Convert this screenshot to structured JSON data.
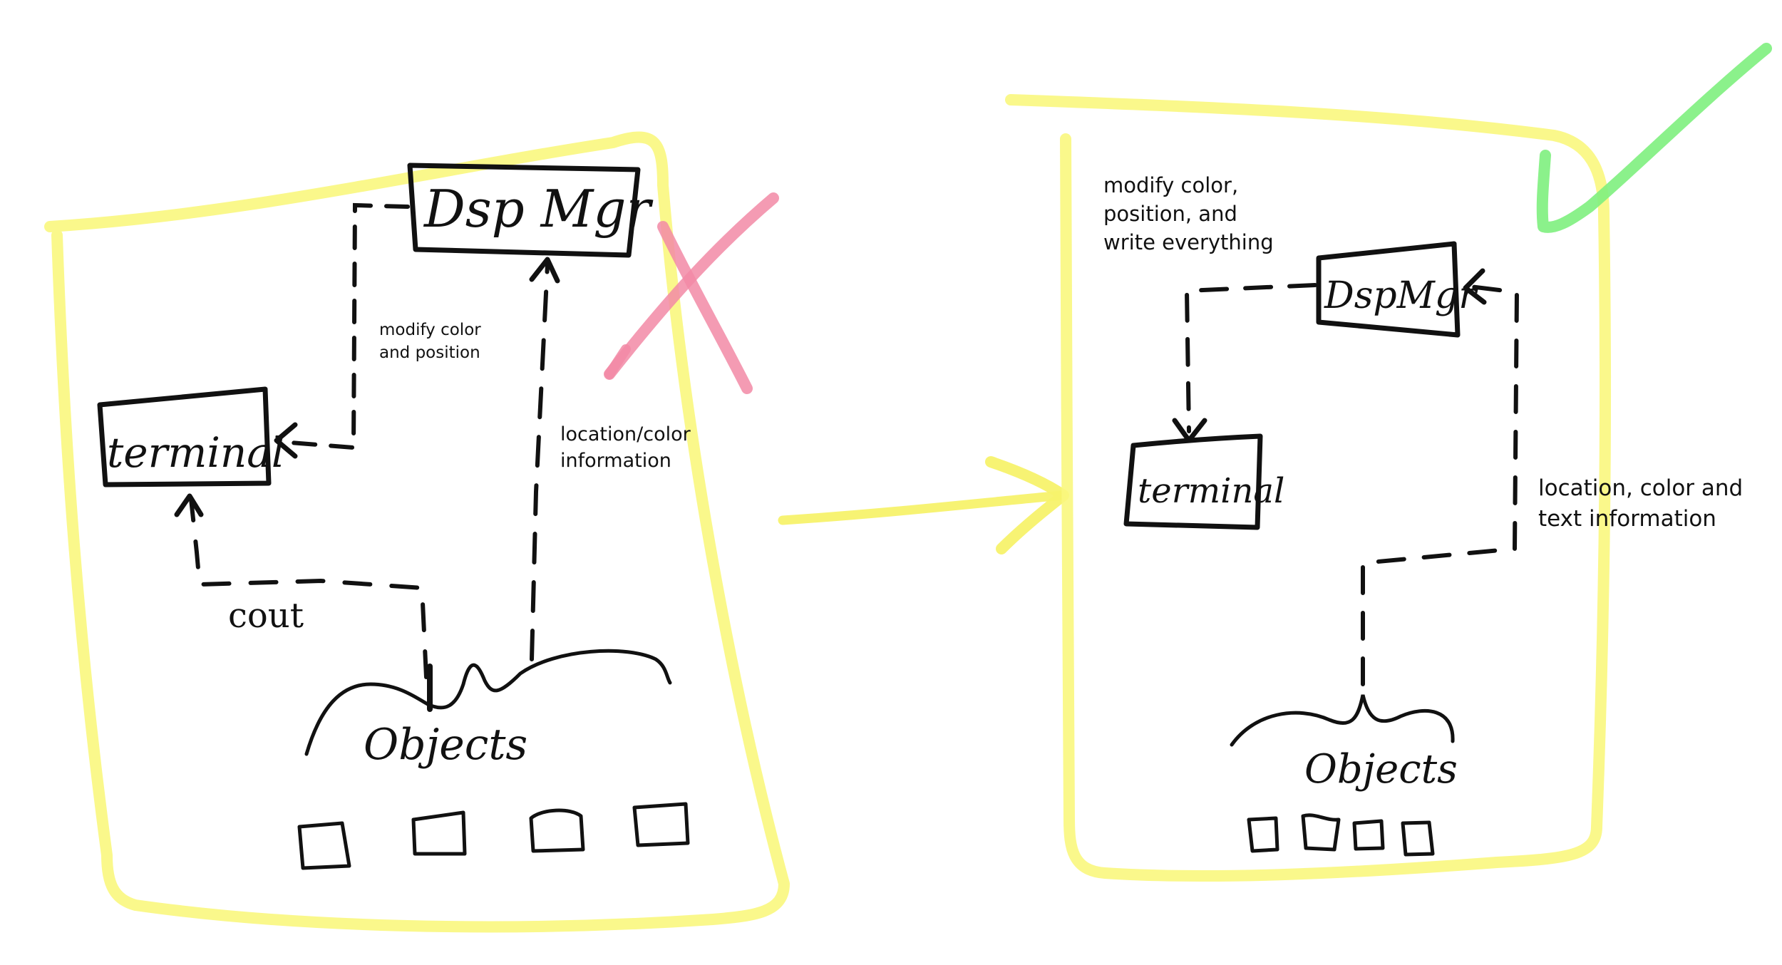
{
  "colors": {
    "ink": "#111111",
    "highlight_yellow": "#faf77e",
    "reject_pink": "#f28aa6",
    "approve_green": "#7ef07e",
    "transition_arrow": "#f7f26b",
    "background": "#ffffff"
  },
  "left_diagram": {
    "dspmgr_label": "Dsp Mgr",
    "terminal_label": "terminal",
    "note_modify_line1": "modify color",
    "note_modify_line2": "and position",
    "note_location_line1": "location/color",
    "note_location_line2": "information",
    "cout_label": "cout",
    "objects_label": "Objects",
    "marker_icon": "cross-mark-icon"
  },
  "right_diagram": {
    "dspmgr_label": "DspMgr",
    "terminal_label": "terminal",
    "note_modify_line1": "modify color,",
    "note_modify_line2": "position, and",
    "note_modify_line3": "write everything",
    "note_location_line1": "location, color and",
    "note_location_line2": "text information",
    "objects_label": "Objects",
    "marker_icon": "check-mark-icon"
  },
  "transition_icon": "right-arrow-icon"
}
